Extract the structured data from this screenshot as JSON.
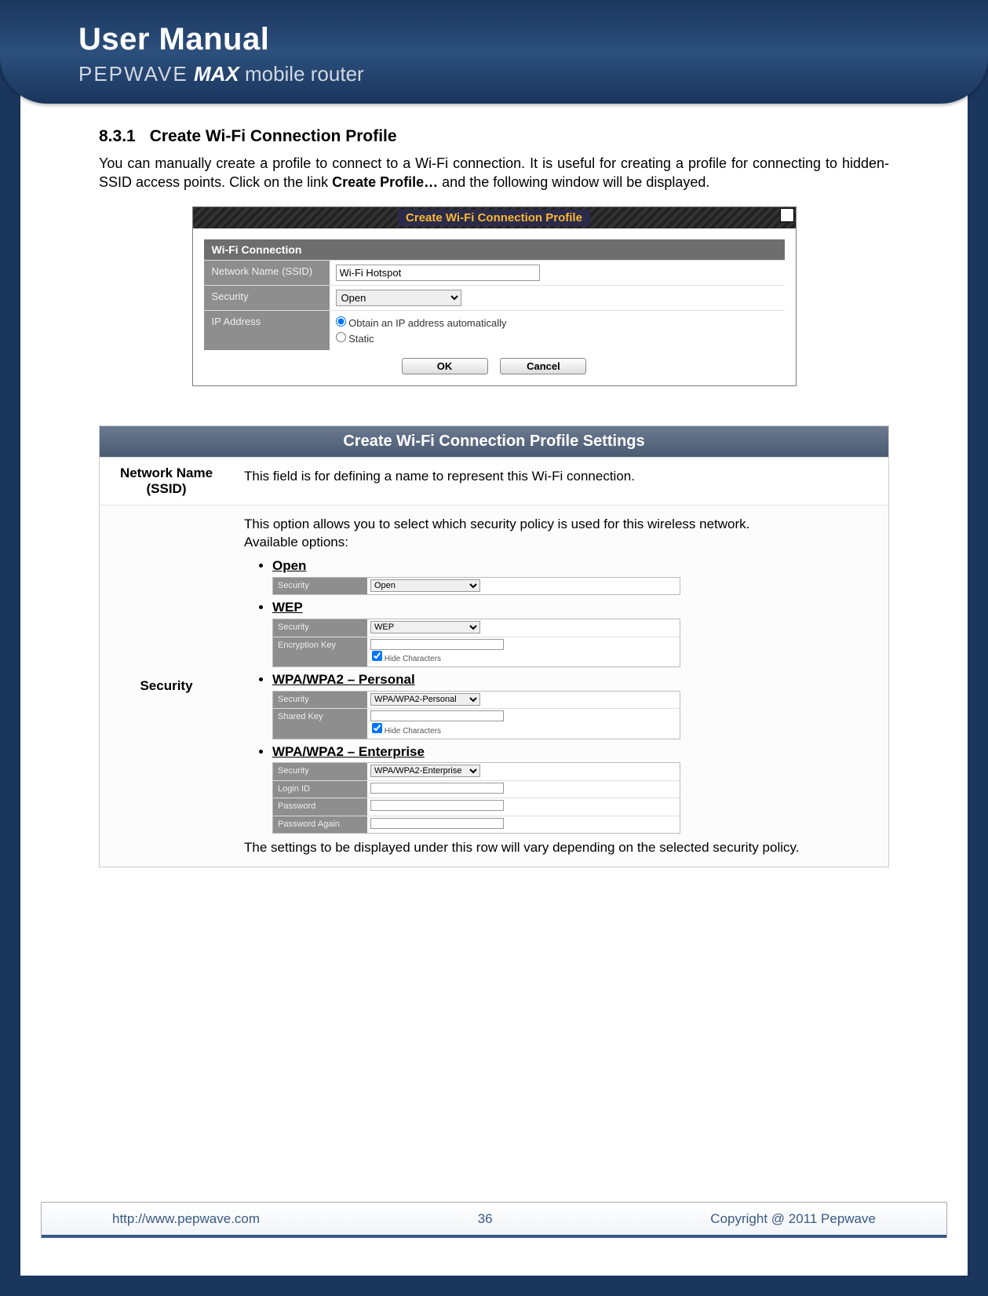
{
  "header": {
    "title": "User Manual",
    "brand": "PEPWAVE",
    "product": "MAX",
    "tagline": "mobile router"
  },
  "section": {
    "number": "8.3.1",
    "title": "Create Wi-Fi Connection Profile",
    "intro_pre": "You can manually create a profile to connect to a Wi-Fi connection.  It is useful for creating a profile for connecting to hidden-SSID access points.  Click on the link ",
    "intro_bold": "Create Profile…",
    "intro_post": " and the following window will be displayed."
  },
  "dialog": {
    "title": "Create Wi-Fi Connection Profile",
    "section_head": "Wi-Fi Connection",
    "rows": {
      "ssid_label": "Network Name (SSID)",
      "ssid_value": "Wi-Fi Hotspot",
      "security_label": "Security",
      "security_value": "Open",
      "ip_label": "IP Address",
      "ip_opt1": "Obtain an IP address automatically",
      "ip_opt2": "Static"
    },
    "ok": "OK",
    "cancel": "Cancel"
  },
  "settings": {
    "head": "Create Wi-Fi Connection Profile Settings",
    "row1_label_a": "Network Name",
    "row1_label_b": "(SSID)",
    "row1_desc": "This field is for defining a name to represent this Wi-Fi connection.",
    "row2_label": "Security",
    "row2_intro1": "This option allows you to select which security policy is used for this wireless network.",
    "row2_intro2": "Available options:",
    "opts": {
      "open": "Open",
      "wep": "WEP",
      "wpa_p": "WPA/WPA2 – Personal",
      "wpa_e": "WPA/WPA2 – Enterprise"
    },
    "row2_outro": "The settings to be displayed under this row will vary depending on the selected security policy."
  },
  "mini": {
    "security": "Security",
    "open": "Open",
    "wep": "WEP",
    "wpa_p": "WPA/WPA2-Personal",
    "wpa_e": "WPA/WPA2-Enterprise",
    "enc_key": "Encryption Key",
    "shared_key": "Shared Key",
    "hide": "Hide Characters",
    "login": "Login ID",
    "password": "Password",
    "password2": "Password Again"
  },
  "footer": {
    "url": "http://www.pepwave.com",
    "page": "36",
    "copyright": "Copyright @ 2011 Pepwave"
  }
}
